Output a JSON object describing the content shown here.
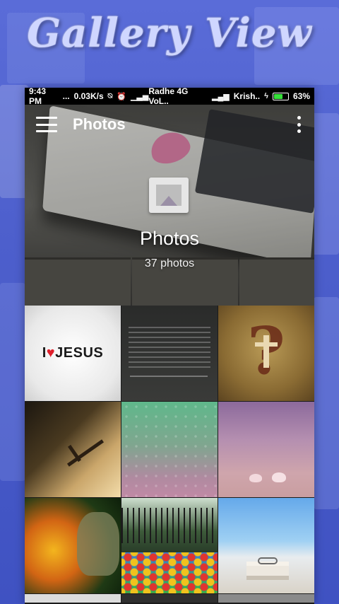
{
  "promo": {
    "title": "Gallery View"
  },
  "statusbar": {
    "time": "9:43 PM",
    "dots": "...",
    "speed": "0.03K/s",
    "carrier1": "Radhe 4G VoL..",
    "carrier2": "Krish..",
    "battery": "63%",
    "battery_level": 0.63
  },
  "appbar": {
    "title": "Photos"
  },
  "album": {
    "name": "Photos",
    "count": "37 photos"
  },
  "grid": {
    "tile1_text_before": "I",
    "tile1_heart": "♥",
    "tile1_text_after": "JESUS",
    "tile3_symbol": "?"
  },
  "colors": {
    "background": "#4d5fcc",
    "battery_fill": "#36e03a",
    "heart": "#e0202c"
  },
  "icons": {
    "menu": "hamburger-menu-icon",
    "more": "more-vert-icon",
    "album": "image-placeholder-icon",
    "alarm": "alarm-icon",
    "vibrate": "vibrate-icon",
    "signal": "signal-icon",
    "charging": "charging-bolt-icon"
  }
}
